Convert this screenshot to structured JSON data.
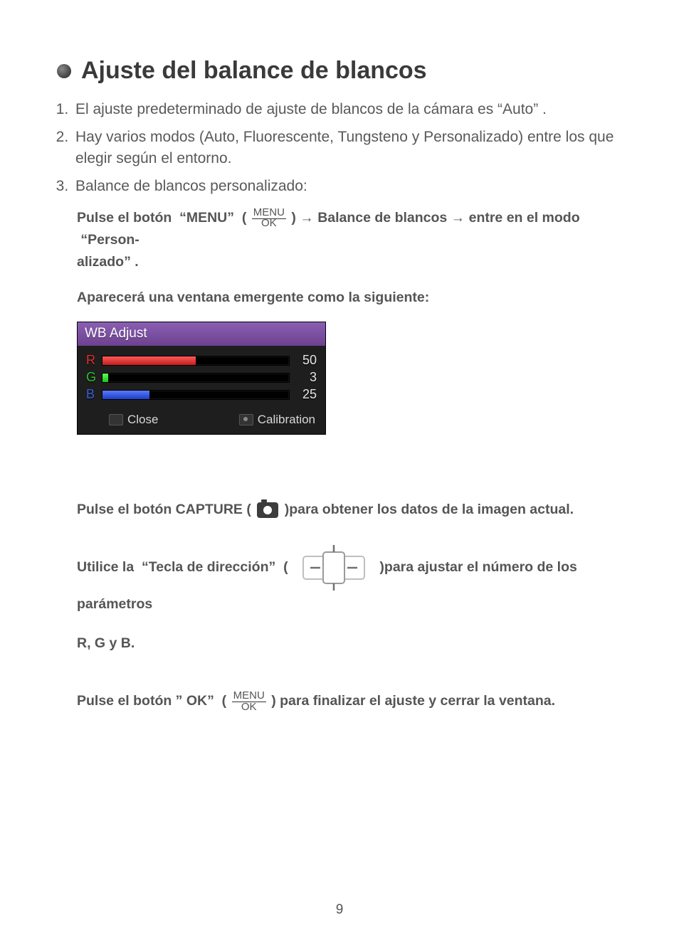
{
  "title": "Ajuste del balance de blancos",
  "list": {
    "item1": "El ajuste predeterminado de ajuste de blancos de la cámara es “Auto” .",
    "item2": "Hay varios modos (Auto, Fluorescente, Tungsteno y Personalizado) entre los que elegir según el entorno.",
    "item3": "Balance de blancos personalizado:"
  },
  "step1_a": "Pulse el botón  “MENU”  (",
  "step1_b": ") → Balance de blancos → entre en el modo  “Person-",
  "step1_c": "alizado” .",
  "step2": "Aparecerá una ventana emergente como la siguiente:",
  "menuok": {
    "top": "MENU",
    "bot": "OK"
  },
  "wb": {
    "title": "WB Adjust",
    "r_label": "R",
    "r_value": "50",
    "r_fill": 50,
    "g_label": "G",
    "g_value": "3",
    "g_fill": 3,
    "b_label": "B",
    "b_value": "25",
    "b_fill": 25,
    "close": "Close",
    "calibration": "Calibration"
  },
  "capture_a": "Pulse el botón CAPTURE (",
  "capture_b": ")para obtener los datos de la imagen actual.",
  "dir_a": "Utilice la  “Tecla de dirección”  (",
  "dir_b": ")para ajustar el número de los parámetros",
  "dir_c": "R, G y B.",
  "ok_a": "Pulse el botón ” OK”  (",
  "ok_b": ") para finalizar el ajuste y cerrar la ventana.",
  "page_number": "9"
}
